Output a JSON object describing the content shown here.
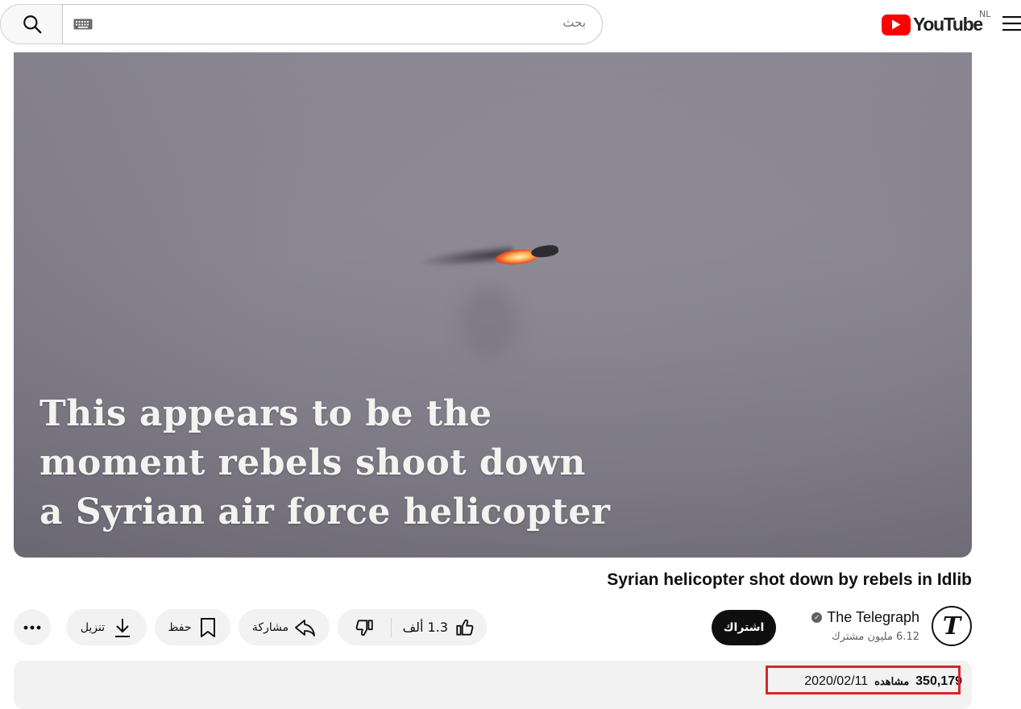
{
  "header": {
    "search_placeholder": "بحث",
    "logo_text": "YouTube",
    "country_code": "NL",
    "icons": [
      "search-icon",
      "keyboard-icon",
      "youtube-logo",
      "hamburger-menu-icon"
    ]
  },
  "video": {
    "caption_lines": [
      "This appears to be the",
      "moment rebels shoot down",
      "a Syrian air force helicopter"
    ],
    "title": "Syrian helicopter shot down by rebels in Idlib"
  },
  "channel": {
    "name": "The Telegraph",
    "subscribers": "6.12 مليون مشترك",
    "avatar_letter": "T",
    "subscribe_label": "اشتراك"
  },
  "actions": {
    "like_count": "1.3 ألف",
    "share_label": "مشاركة",
    "save_label": "حفظ",
    "download_label": "تنزيل"
  },
  "description": {
    "views": "350,179",
    "views_word": "مشاهده",
    "date": "2020/02/11"
  },
  "colors": {
    "brand_red": "#ff0000",
    "highlight_red": "#d9262b",
    "subscribe_bg": "#0f0f0f",
    "pill_bg": "#f2f2f2"
  }
}
